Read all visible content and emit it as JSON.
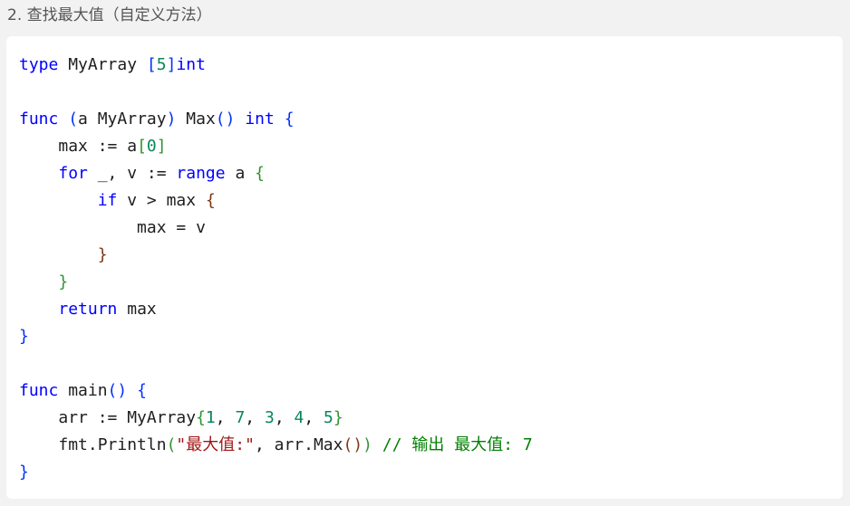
{
  "heading": "2. 查找最大值（自定义方法）",
  "code": {
    "line1": {
      "kw": "type",
      "name": " MyArray ",
      "lb": "[",
      "num": "5",
      "rb": "]",
      "type": "int"
    },
    "line3": {
      "kw": "func",
      "sp1": " ",
      "lp": "(",
      "recv": "a MyArray",
      "rp": ")",
      "name": " Max",
      "plp": "(",
      "prp": ")",
      "sp2": " ",
      "type": "int",
      "sp3": " ",
      "lb": "{"
    },
    "line4": {
      "indent": "    ",
      "text": "max := a",
      "lb": "[",
      "num": "0",
      "rb": "]"
    },
    "line5": {
      "indent": "    ",
      "kw": "for",
      "text": " _, v := ",
      "kw2": "range",
      "text2": " a ",
      "lb": "{"
    },
    "line6": {
      "indent": "        ",
      "kw": "if",
      "text": " v > max ",
      "lb": "{"
    },
    "line7": {
      "indent": "            ",
      "text": "max = v"
    },
    "line8": {
      "indent": "        ",
      "rb": "}"
    },
    "line9": {
      "indent": "    ",
      "rb": "}"
    },
    "line10": {
      "indent": "    ",
      "kw": "return",
      "text": " max"
    },
    "line11": {
      "rb": "}"
    },
    "line13": {
      "kw": "func",
      "name": " main",
      "lp": "(",
      "rp": ")",
      "sp": " ",
      "lb": "{"
    },
    "line14": {
      "indent": "    ",
      "text": "arr := MyArray",
      "lb": "{",
      "n1": "1",
      "c1": ", ",
      "n2": "7",
      "c2": ", ",
      "n3": "3",
      "c3": ", ",
      "n4": "4",
      "c4": ", ",
      "n5": "5",
      "rb": "}"
    },
    "line15": {
      "indent": "    ",
      "text": "fmt.Println",
      "lp": "(",
      "str": "\"最大值:\"",
      "text2": ", arr.Max",
      "lp2": "(",
      "rp2": ")",
      "rp": ")",
      "sp": " ",
      "comment": "// 输出 最大值: 7"
    },
    "line16": {
      "rb": "}"
    }
  }
}
